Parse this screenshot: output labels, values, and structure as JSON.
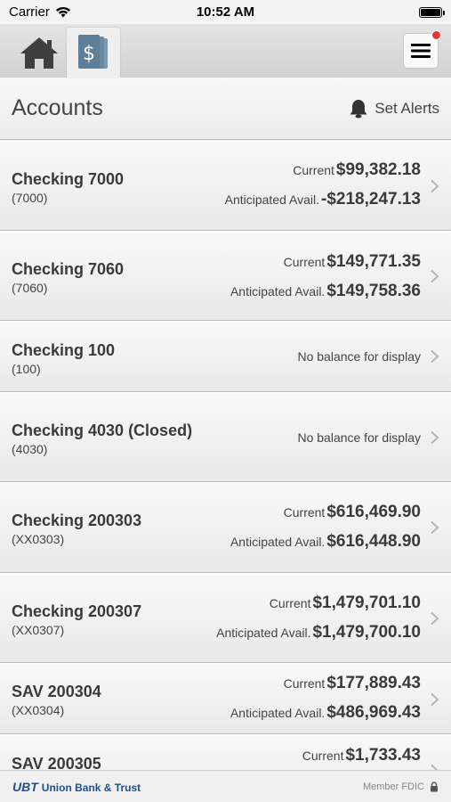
{
  "status_bar": {
    "carrier": "Carrier",
    "time": "10:52 AM"
  },
  "nav": {
    "icons": [
      "home-icon",
      "accounts-dollar-icon",
      "hamburger-menu-icon"
    ],
    "menu_has_notification": true
  },
  "header": {
    "title": "Accounts",
    "alerts_label": "Set Alerts"
  },
  "accounts": [
    {
      "name": "Checking 7000",
      "number": "(7000)",
      "current_label": "Current",
      "current": "$99,382.18",
      "anticipated_label": "Anticipated Avail.",
      "anticipated": "-$218,247.13"
    },
    {
      "name": "Checking 7060",
      "number": "(7060)",
      "current_label": "Current",
      "current": "$149,771.35",
      "anticipated_label": "Anticipated Avail.",
      "anticipated": "$149,758.36"
    },
    {
      "name": "Checking 100",
      "number": "(100)",
      "no_balance": "No balance for display"
    },
    {
      "name": "Checking 4030 (Closed)",
      "number": "(4030)",
      "no_balance": "No balance for display"
    },
    {
      "name": "Checking 200303",
      "number": "(XX0303)",
      "current_label": "Current",
      "current": "$616,469.90",
      "anticipated_label": "Anticipated Avail.",
      "anticipated": "$616,448.90"
    },
    {
      "name": "Checking 200307",
      "number": "(XX0307)",
      "current_label": "Current",
      "current": "$1,479,701.10",
      "anticipated_label": "Anticipated Avail.",
      "anticipated": "$1,479,700.10"
    },
    {
      "name": "SAV 200304",
      "number": "(XX0304)",
      "current_label": "Current",
      "current": "$177,889.43",
      "anticipated_label": "Anticipated Avail.",
      "anticipated": "$486,969.43"
    },
    {
      "name": "SAV 200305",
      "number": "",
      "current_label": "Current",
      "current": "$1,733.43"
    }
  ],
  "footer": {
    "logo_mark": "UBT",
    "logo_text": "Union Bank & Trust",
    "member": "Member FDIC"
  },
  "colors": {
    "brand": "#1f4f8f",
    "notification": "#e8313b",
    "accounts_icon": "#5e7f97"
  }
}
